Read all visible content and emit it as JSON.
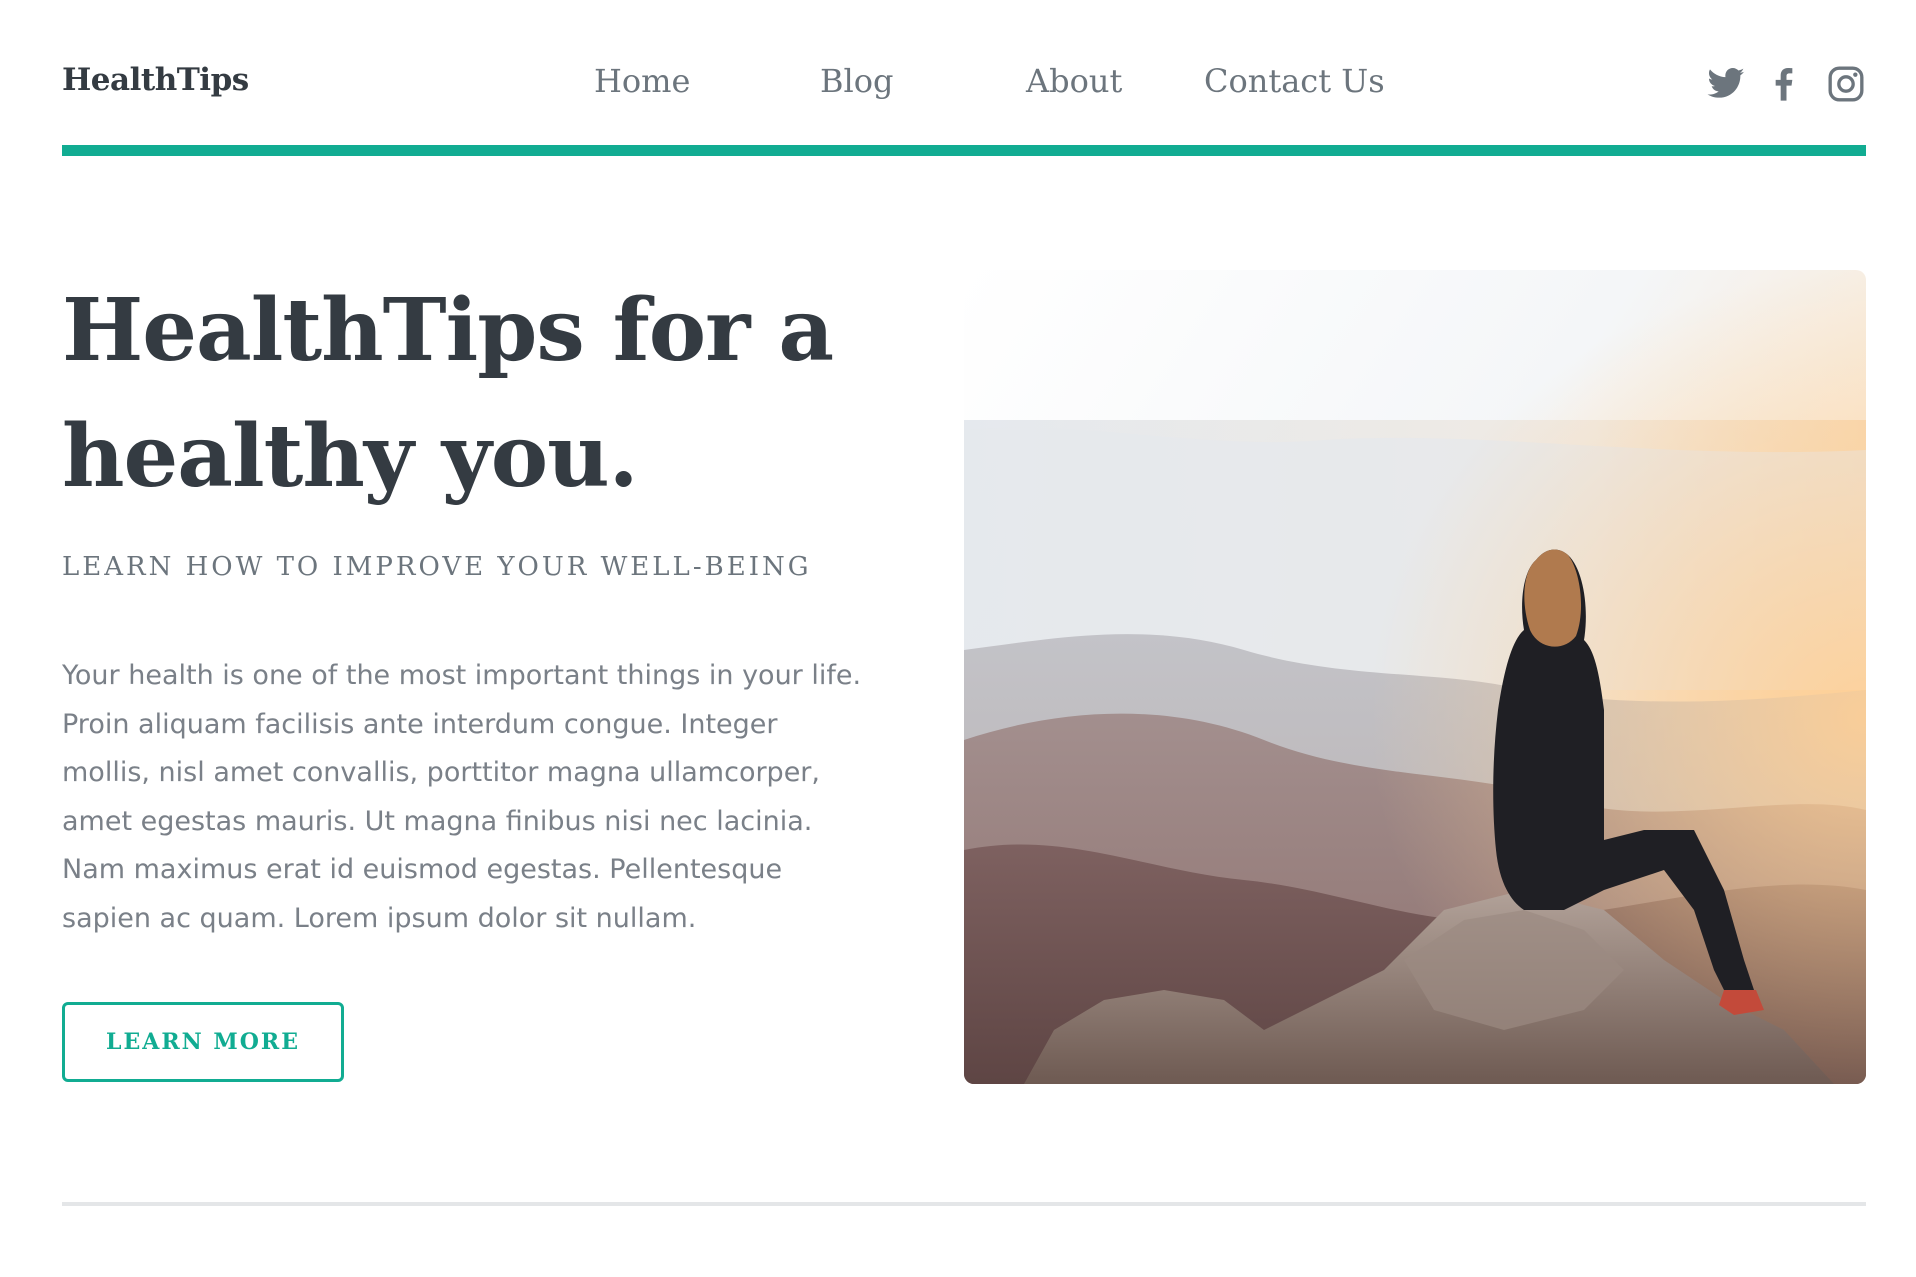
{
  "header": {
    "logo": "HealthTips",
    "nav": {
      "home": "Home",
      "blog": "Blog",
      "about": "About",
      "contact": "Contact Us"
    },
    "social": [
      "twitter-icon",
      "facebook-icon",
      "instagram-icon"
    ]
  },
  "hero": {
    "title": "HealthTips for a healthy you.",
    "subtitle": "LEARN HOW TO IMPROVE YOUR WELL-BEING",
    "body": "Your health is one of the most important things in your life. Proin aliquam facilisis ante interdum congue. Integer mollis, nisl amet convallis, porttitor magna ullamcorper, amet egestas mauris. Ut magna finibus nisi nec lacinia. Nam maximus erat id euismod egestas. Pellentesque sapien ac quam. Lorem ipsum dolor sit nullam.",
    "button_label": "LEARN MORE",
    "image": "photo of a woman sitting on a mountain rock at sunset"
  },
  "colors": {
    "accent": "#11ac92",
    "text_dark": "#343b42",
    "text_muted": "#6c757d",
    "divider": "#e4e6e8"
  }
}
